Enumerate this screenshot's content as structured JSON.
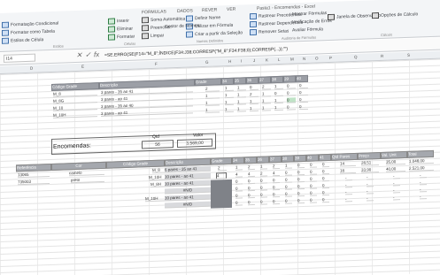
{
  "title_bar": "Pasta1 - Encomendas - Excel",
  "ribbon": {
    "tabs": [
      "FÓRMULAS",
      "DADOS",
      "REVER",
      "VER"
    ],
    "left_items": [
      "Formatação Condicional",
      "Formatar como Tabela",
      "Estilos de Célula"
    ],
    "left_group": "Estilos",
    "cells_items": [
      "Inserir",
      "Eliminar",
      "Formatar"
    ],
    "cells_group": "Células",
    "autosum": [
      "Soma Automática",
      "Preencher",
      "Limpar"
    ],
    "sort": "Ordenar e Filtrar",
    "find": "Localizar e Selecionar",
    "audit_items": [
      "Rastrear Precedentes",
      "Rastrear Dependentes",
      "Remover Setas"
    ],
    "audit_items2": [
      "Mostrar Fórmulas",
      "Verificação de Erros",
      "Avaliar Fórmula"
    ],
    "watch": "Janela de Observação",
    "calc": "Opções de Cálculo",
    "audit_group": "Auditoria de Fórmulas",
    "calc_group": "Cálculo",
    "defined_items": [
      "Definir Nome",
      "Utilizar em Fórmula",
      "Criar a partir da Seleção"
    ],
    "name_mgr": "Gestor de Nomes",
    "defined_group": "Nomes Definidos"
  },
  "formula_bar": {
    "name_box": "I14",
    "formula": "=SE.ERRO(SE(F14=\"M_8\";ÍNDICE(F34:J38;CORRESP(\"M_8\";F34:F38;0);CORRESP(...));\"\")"
  },
  "columns": [
    "D",
    "E",
    "F",
    "G",
    "H",
    "I",
    "J",
    "K",
    "L",
    "M",
    "N",
    "O",
    "P",
    "Q",
    "R",
    "S"
  ],
  "table1": {
    "headers": [
      "Código Grade",
      "Descrição",
      "Grade",
      "34",
      "35",
      "36",
      "37",
      "38",
      "39",
      "40"
    ],
    "rows": [
      [
        "M_8",
        "3 pares - 35 ao 41",
        "2",
        "1",
        "1",
        "0",
        "2",
        "1",
        "0",
        "0"
      ],
      [
        "M_8G",
        "3 pares - ao 41",
        "1",
        "1",
        "1",
        "2",
        "1",
        "0",
        "0",
        "0"
      ],
      [
        "M_10",
        "3 pares - 35 ao 40",
        "1",
        "1",
        "1",
        "1",
        "1",
        "1",
        "0",
        "0"
      ],
      [
        "M_10H",
        "3 pares - ao 41",
        "1",
        "1",
        "1",
        "1",
        "1",
        "1",
        "0",
        "0"
      ]
    ]
  },
  "summary": {
    "label": "Encomendas:",
    "qty_header": "Qtd",
    "val_header": "Valor",
    "qty": "56",
    "value": "3.569,00"
  },
  "table2": {
    "headers": [
      "Referência",
      "Cor",
      "Código Grade",
      "Descrição",
      "Grade",
      "34",
      "35",
      "36",
      "37",
      "38",
      "39",
      "40",
      "41",
      "Qtd Pares",
      "Preço",
      "Val. Unit",
      "Total"
    ],
    "rows": [
      [
        "13065",
        "camelo",
        "M_8",
        "6 pares - 35 ao 41",
        "2",
        "1",
        "2",
        "1",
        "2",
        "1",
        "0",
        "0",
        "0",
        "14",
        "28,51",
        "35,00",
        "1.048,00"
      ],
      [
        "735003",
        "preto",
        "M_10H",
        "10 pares - ao 41",
        "4",
        "4",
        "4",
        "2",
        "4",
        "0",
        "0",
        "0",
        "0",
        "18",
        "33,90",
        "40,00",
        "2.521,00"
      ],
      [
        "",
        "",
        "M_8H",
        "10 pares - ao 41",
        "",
        "0",
        "0",
        "0",
        "0",
        "0",
        "0",
        "0",
        "0",
        "-",
        "-",
        "-",
        "-"
      ],
      [
        "",
        "",
        "",
        "#N/D",
        "",
        "0",
        "0",
        "0",
        "0",
        "0",
        "0",
        "0",
        "0",
        "-",
        "-",
        "-",
        "-"
      ],
      [
        "",
        "",
        "M_10H",
        "10 pares - ao 41",
        "",
        "0",
        "0",
        "0",
        "0",
        "0",
        "0",
        "0",
        "0",
        "-",
        "-",
        "-",
        "-"
      ],
      [
        "",
        "",
        "",
        "#N/D",
        "",
        "0",
        "0",
        "0",
        "0",
        "0",
        "0",
        "0",
        "0",
        "-",
        "-",
        "-",
        "-"
      ]
    ]
  }
}
